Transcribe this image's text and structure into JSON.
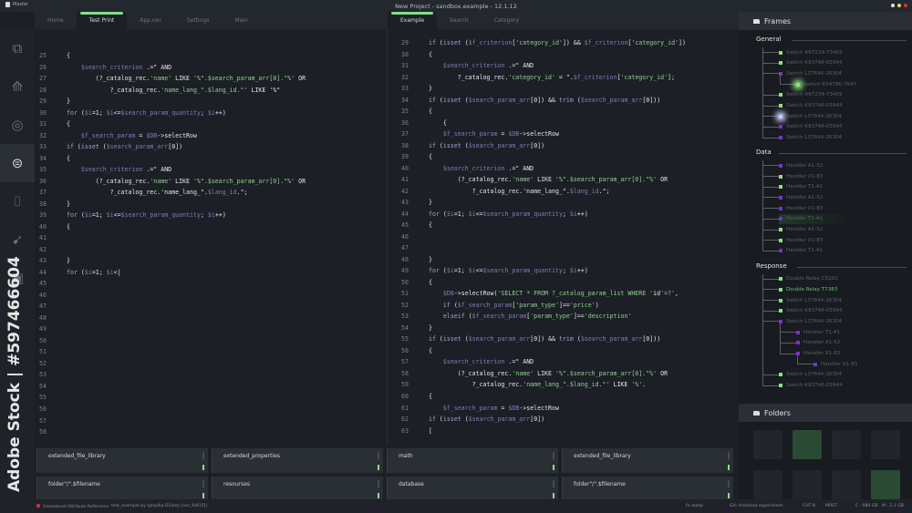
{
  "titlebar": {
    "app": "Master",
    "title": "New Project - sandbox.example - 12.1.12",
    "window_dots": [
      "#e8e8e8",
      "#e6e04a",
      "#d8313a"
    ]
  },
  "left_tabs": [
    {
      "label": "Home"
    },
    {
      "label": "Test Print",
      "active": true
    },
    {
      "label": "App.ner"
    },
    {
      "label": "Settings"
    },
    {
      "label": "Main"
    }
  ],
  "right_tabs": [
    {
      "label": "Example",
      "active": true
    },
    {
      "label": "Search"
    },
    {
      "label": "Category"
    }
  ],
  "sidebar_icons": [
    "layers-icon",
    "network-icon",
    "target-icon",
    "database-icon",
    "bracket-icon",
    "cursor-icon",
    "brand-icon"
  ],
  "watermark": "Adobe Stock | #597466604",
  "left_editor": {
    "lines": [
      {
        "n": "25",
        "code": "{"
      },
      {
        "n": "26",
        "code": "    $search_criterion .=\" AND"
      },
      {
        "n": "27",
        "code": "        (?_catalog_rec.'name' LIKE '%\".$search_param_arr[0].\"%' OR"
      },
      {
        "n": "28",
        "code": "            ?_catalog_rec.'name_lang_\".$lang_id.\"' LIKE '%\""
      },
      {
        "n": "29",
        "code": "}"
      },
      {
        "n": "30",
        "code": "for ($i=1; $i<=$search_param_quantity; $i++)"
      },
      {
        "n": "31",
        "code": "{"
      },
      {
        "n": "32",
        "code": "    $f_search_param = $DB->selectRow"
      },
      {
        "n": "33",
        "code": "if (isset ($search_param_arr[0])"
      },
      {
        "n": "34",
        "code": "{"
      },
      {
        "n": "35",
        "code": "    $search_criterion .=\" AND"
      },
      {
        "n": "36",
        "code": "        (?_catalog_rec.'name' LIKE '%\".$search_param_arr[0].\"%' OR"
      },
      {
        "n": "37",
        "code": "            ?_catalog_rec.'name_lang_\".$lang_id.\";"
      },
      {
        "n": "38",
        "code": "}"
      },
      {
        "n": "39",
        "code": "for ($i=1; $i<=$search_param_quantity; $i++)"
      },
      {
        "n": "40",
        "code": "{"
      },
      {
        "n": "41",
        "code": ""
      },
      {
        "n": "42",
        "code": ""
      },
      {
        "n": "43",
        "code": "}"
      },
      {
        "n": "44",
        "code": "for ($i=1; $i<|"
      },
      {
        "n": "45",
        "code": ""
      },
      {
        "n": "46",
        "code": ""
      },
      {
        "n": "47",
        "code": ""
      },
      {
        "n": "48",
        "code": ""
      },
      {
        "n": "49",
        "code": ""
      },
      {
        "n": "50",
        "code": ""
      },
      {
        "n": "51",
        "code": ""
      },
      {
        "n": "52",
        "code": ""
      },
      {
        "n": "53",
        "code": ""
      },
      {
        "n": "54",
        "code": ""
      },
      {
        "n": "55",
        "code": ""
      },
      {
        "n": "56",
        "code": ""
      },
      {
        "n": "57",
        "code": ""
      },
      {
        "n": "58",
        "code": ""
      }
    ]
  },
  "right_editor": {
    "lines": [
      {
        "n": "29",
        "code": "if (isset ($f_criterion['category_id']) && $f_criterion['category_id'])"
      },
      {
        "n": "30",
        "code": "{"
      },
      {
        "n": "31",
        "code": "    $search_criterion .=\" AND"
      },
      {
        "n": "32",
        "code": "        ?_catalog_rec.'category_id' = \".$f_criterion['category_id'];"
      },
      {
        "n": "33",
        "code": "}"
      },
      {
        "n": "34",
        "code": "if (isset ($search_param_arr[0]) && trim ($search_param_arr[0]))"
      },
      {
        "n": "35",
        "code": "{"
      },
      {
        "n": "36",
        "code": "    {"
      },
      {
        "n": "37",
        "code": "    $f_search_param = $DB->selectRow"
      },
      {
        "n": "38",
        "code": "if (isset ($search_param_arr[0])"
      },
      {
        "n": "39",
        "code": "{"
      },
      {
        "n": "40",
        "code": "    $search_criterion .=\" AND"
      },
      {
        "n": "41",
        "code": "        (?_catalog_rec.'name' LIKE '%\".$search_param_arr[0].\"%' OR"
      },
      {
        "n": "42",
        "code": "            ?_catalog_rec.'name_lang_\".$lang_id.\";"
      },
      {
        "n": "43",
        "code": "}"
      },
      {
        "n": "44",
        "code": "for ($i=1; $i<=$search_param_quantity; $i++)"
      },
      {
        "n": "45",
        "code": "{"
      },
      {
        "n": "46",
        "code": ""
      },
      {
        "n": "47",
        "code": ""
      },
      {
        "n": "48",
        "code": "}"
      },
      {
        "n": "49",
        "code": "for ($i=1; $i<=$search_param_quantity; $i++)"
      },
      {
        "n": "50",
        "code": "{"
      },
      {
        "n": "51",
        "code": "    $DB->selectRow('SELECT * FROM ?_catalog_param_list WHERE 'id'=?',"
      },
      {
        "n": "52",
        "code": "    if ($f_search_param['param_type']=='price')"
      },
      {
        "n": "53",
        "code": "    elseif ($f_search_param['param_type']=='description'"
      },
      {
        "n": "54",
        "code": "}"
      },
      {
        "n": "55",
        "code": "if (isset ($search_param_arr[0]) && trim ($search_param_arr[0]))"
      },
      {
        "n": "56",
        "code": "{"
      },
      {
        "n": "57",
        "code": "    $search_criterion .=\" AND"
      },
      {
        "n": "58",
        "code": "        (?_catalog_rec.'name' LIKE '%\".$search_param_arr[0].\"%' OR"
      },
      {
        "n": "59",
        "code": "            ?_catalog_rec.'name_lang_\".$lang_id.\"' LIKE '%'."
      },
      {
        "n": "60",
        "code": "{"
      },
      {
        "n": "61",
        "code": "    $f_search_param = $DB->selectRow"
      },
      {
        "n": "62",
        "code": "if (isset ($search_param_arr[0])"
      },
      {
        "n": "63",
        "code": "["
      }
    ]
  },
  "frames": {
    "title": "Frames",
    "sections": [
      {
        "name": "General",
        "items": [
          {
            "label": "Switch A97234-73465",
            "color": "#8ee07e",
            "depth": 0
          },
          {
            "label": "Switch K93748-03944",
            "color": "#8ee07e",
            "depth": 0
          },
          {
            "label": "Switch L37644-26304",
            "color": "#7a2fd0",
            "depth": 0
          },
          {
            "label": "Switch R34786-7647",
            "color": "#8ee07e",
            "depth": 1,
            "glow": true
          },
          {
            "label": "Switch A97234-73465",
            "color": "#8ee07e",
            "depth": 0
          },
          {
            "label": "Switch K93748-03944",
            "color": "#8ee07e",
            "depth": 0
          },
          {
            "label": "Switch L37644-26304",
            "color": "#c8c8ff",
            "depth": 0,
            "glow": true
          },
          {
            "label": "Switch K93748-03944",
            "color": "#7a2fd0",
            "depth": 0
          },
          {
            "label": "Switch L37644-26304",
            "color": "#7a2fd0",
            "depth": 0
          }
        ]
      },
      {
        "name": "Data",
        "items": [
          {
            "label": "Handler A1-52",
            "color": "#7a2fd0",
            "depth": 0
          },
          {
            "label": "Handler X1-83",
            "color": "#8ee07e",
            "depth": 0
          },
          {
            "label": "Handler T1-41",
            "color": "#8ee07e",
            "depth": 0
          },
          {
            "label": "Handler A1-52",
            "color": "#7a2fd0",
            "depth": 0
          },
          {
            "label": "Handler X1-83",
            "color": "#7a2fd0",
            "depth": 0
          },
          {
            "label": "Handler T1-41",
            "color": "#7a2fd0",
            "depth": 0,
            "highlight": true
          },
          {
            "label": "Handler A1-52",
            "color": "#8ee07e",
            "depth": 0
          },
          {
            "label": "Handler X1-83",
            "color": "#8ee07e",
            "depth": 0
          },
          {
            "label": "Handler T1-41",
            "color": "#7a2fd0",
            "depth": 0
          }
        ]
      },
      {
        "name": "Response",
        "items": [
          {
            "label": "Double Relay C5282",
            "color": "#8ee07e",
            "depth": 0
          },
          {
            "label": "Double Relay T7383",
            "color": "#8ee07e",
            "depth": 0,
            "active": true
          },
          {
            "label": "Switch L37644-26304",
            "color": "#8ee07e",
            "depth": 0
          },
          {
            "label": "Switch K93748-03944",
            "color": "#8ee07e",
            "depth": 0
          },
          {
            "label": "Switch L37644-26304",
            "color": "#7a2fd0",
            "depth": 0
          },
          {
            "label": "Handler T1-41",
            "color": "#7a2fd0",
            "depth": 1
          },
          {
            "label": "Handler A1-52",
            "color": "#7a2fd0",
            "depth": 1
          },
          {
            "label": "Handler X1-83",
            "color": "#7a2fd0",
            "depth": 1
          },
          {
            "label": "Handler X1-83",
            "color": "#7a2fd0",
            "depth": 2
          },
          {
            "label": "Switch L37644-26304",
            "color": "#8ee07e",
            "depth": 0
          },
          {
            "label": "Switch K93748-03944",
            "color": "#8ee07e",
            "depth": 0
          }
        ]
      }
    ]
  },
  "folders": {
    "title": "Folders",
    "items": [
      {
        "green": false
      },
      {
        "green": true
      },
      {
        "green": false
      },
      {
        "green": false
      },
      {
        "green": false
      },
      {
        "green": false
      },
      {
        "green": false
      },
      {
        "green": true
      }
    ]
  },
  "bottom_cards": [
    {
      "title": "extended_file_library"
    },
    {
      "title": "extended_properties"
    },
    {
      "title": "math"
    },
    {
      "title": "extended_file_library"
    },
    {
      "title": "folder\"/\".$filename"
    },
    {
      "title": "resourses"
    },
    {
      "title": "database"
    },
    {
      "title": "folder\"/\".$filename"
    }
  ],
  "status": {
    "error": "Unresolved Attribute Reference",
    "file": "test_example.py (php/hp-D1/key [run_fe915])",
    "git_icon": "fx ready",
    "branch": "Git: checkout experiment",
    "encoding": "CHT 8",
    "mode": "MRST",
    "disk_c": "C : 980 GB",
    "disk_m": "M : 2.1 GB"
  }
}
